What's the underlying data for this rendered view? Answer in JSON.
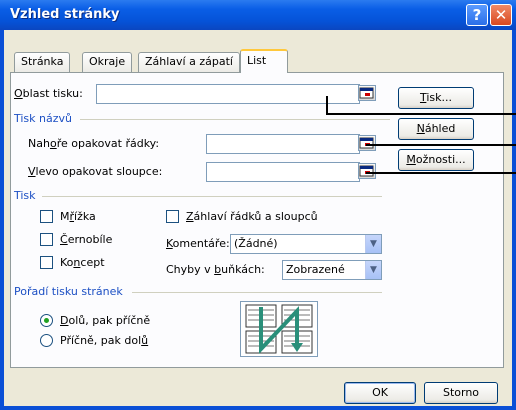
{
  "window": {
    "title": "Vzhled stránky"
  },
  "tabs": [
    {
      "label": "Stránka",
      "active": false
    },
    {
      "label": "Okraje",
      "active": false
    },
    {
      "label": "Záhlaví a zápatí",
      "active": false
    },
    {
      "label": "List",
      "active": true
    }
  ],
  "print_area": {
    "prefix": "O",
    "rest": "blast tisku:",
    "value": ""
  },
  "print_titles": {
    "heading": "Tisk názvů",
    "rows_pre": "Nah",
    "rows_key": "o",
    "rows_post": "ře opakovat řádky:",
    "cols_key": "V",
    "cols_post": "levo opakovat sloupce:"
  },
  "print": {
    "heading": "Tisk",
    "gridlines_pre": "M",
    "gridlines_key": "ř",
    "gridlines_post": "ížka",
    "bw_key": "Č",
    "bw_post": "ernobíle",
    "draft_pre": "Ko",
    "draft_key": "n",
    "draft_post": "cept",
    "headings_key": "Z",
    "headings_post": "áhlaví řádků a sloupců",
    "comments_key": "K",
    "comments_post": "omentáře:",
    "comments_value": "(Žádné)",
    "errors_pre": "Chyby v ",
    "errors_key": "b",
    "errors_post": "uňkách:",
    "errors_value": "Zobrazené"
  },
  "page_order": {
    "heading": "Pořadí tisku stránek",
    "down_key": "D",
    "down_post": "olů, pak příčně",
    "over_pre": "Příčně, pak dol",
    "over_key": "ů"
  },
  "buttons": {
    "print_key": "T",
    "print_post": "isk...",
    "preview_key": "N",
    "preview_post": "áhled",
    "options_key": "M",
    "options_post": "ožnosti...",
    "ok": "OK",
    "cancel": "Storno"
  }
}
